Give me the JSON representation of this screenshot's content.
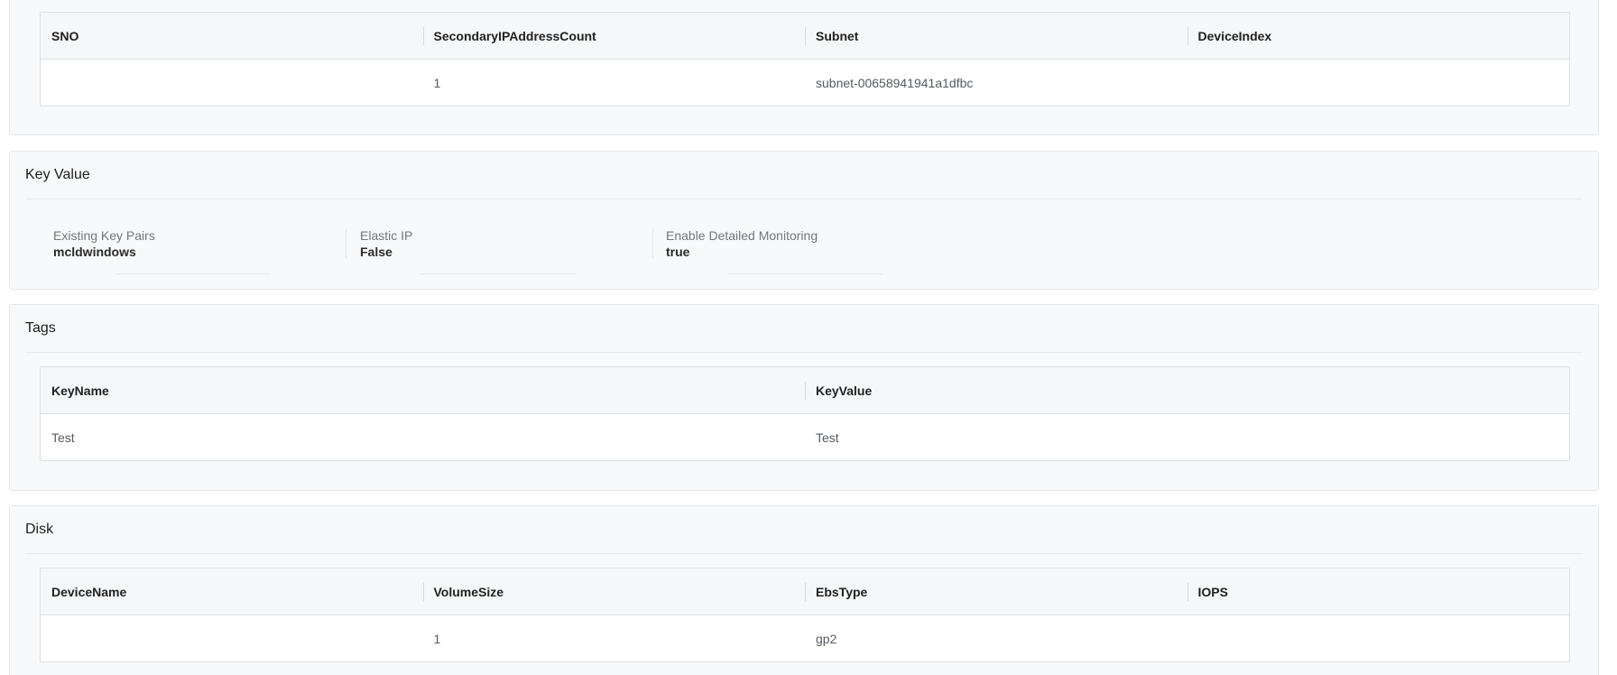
{
  "network_table": {
    "columns": [
      "SNO",
      "SecondaryIPAddressCount",
      "Subnet",
      "DeviceIndex"
    ],
    "rows": [
      [
        "",
        "1",
        "subnet-00658941941a1dfbc",
        ""
      ]
    ]
  },
  "key_value": {
    "title": "Key Value",
    "items": [
      {
        "label": "Existing Key Pairs",
        "value": "mcldwindows"
      },
      {
        "label": "Elastic IP",
        "value": "False"
      },
      {
        "label": "Enable Detailed Monitoring",
        "value": "true"
      }
    ]
  },
  "tags": {
    "title": "Tags",
    "columns": [
      "KeyName",
      "KeyValue"
    ],
    "rows": [
      [
        "Test",
        "Test"
      ]
    ]
  },
  "disk": {
    "title": "Disk",
    "columns": [
      "DeviceName",
      "VolumeSize",
      "EbsType",
      "IOPS"
    ],
    "rows": [
      [
        "",
        "1",
        "gp2",
        ""
      ]
    ]
  }
}
